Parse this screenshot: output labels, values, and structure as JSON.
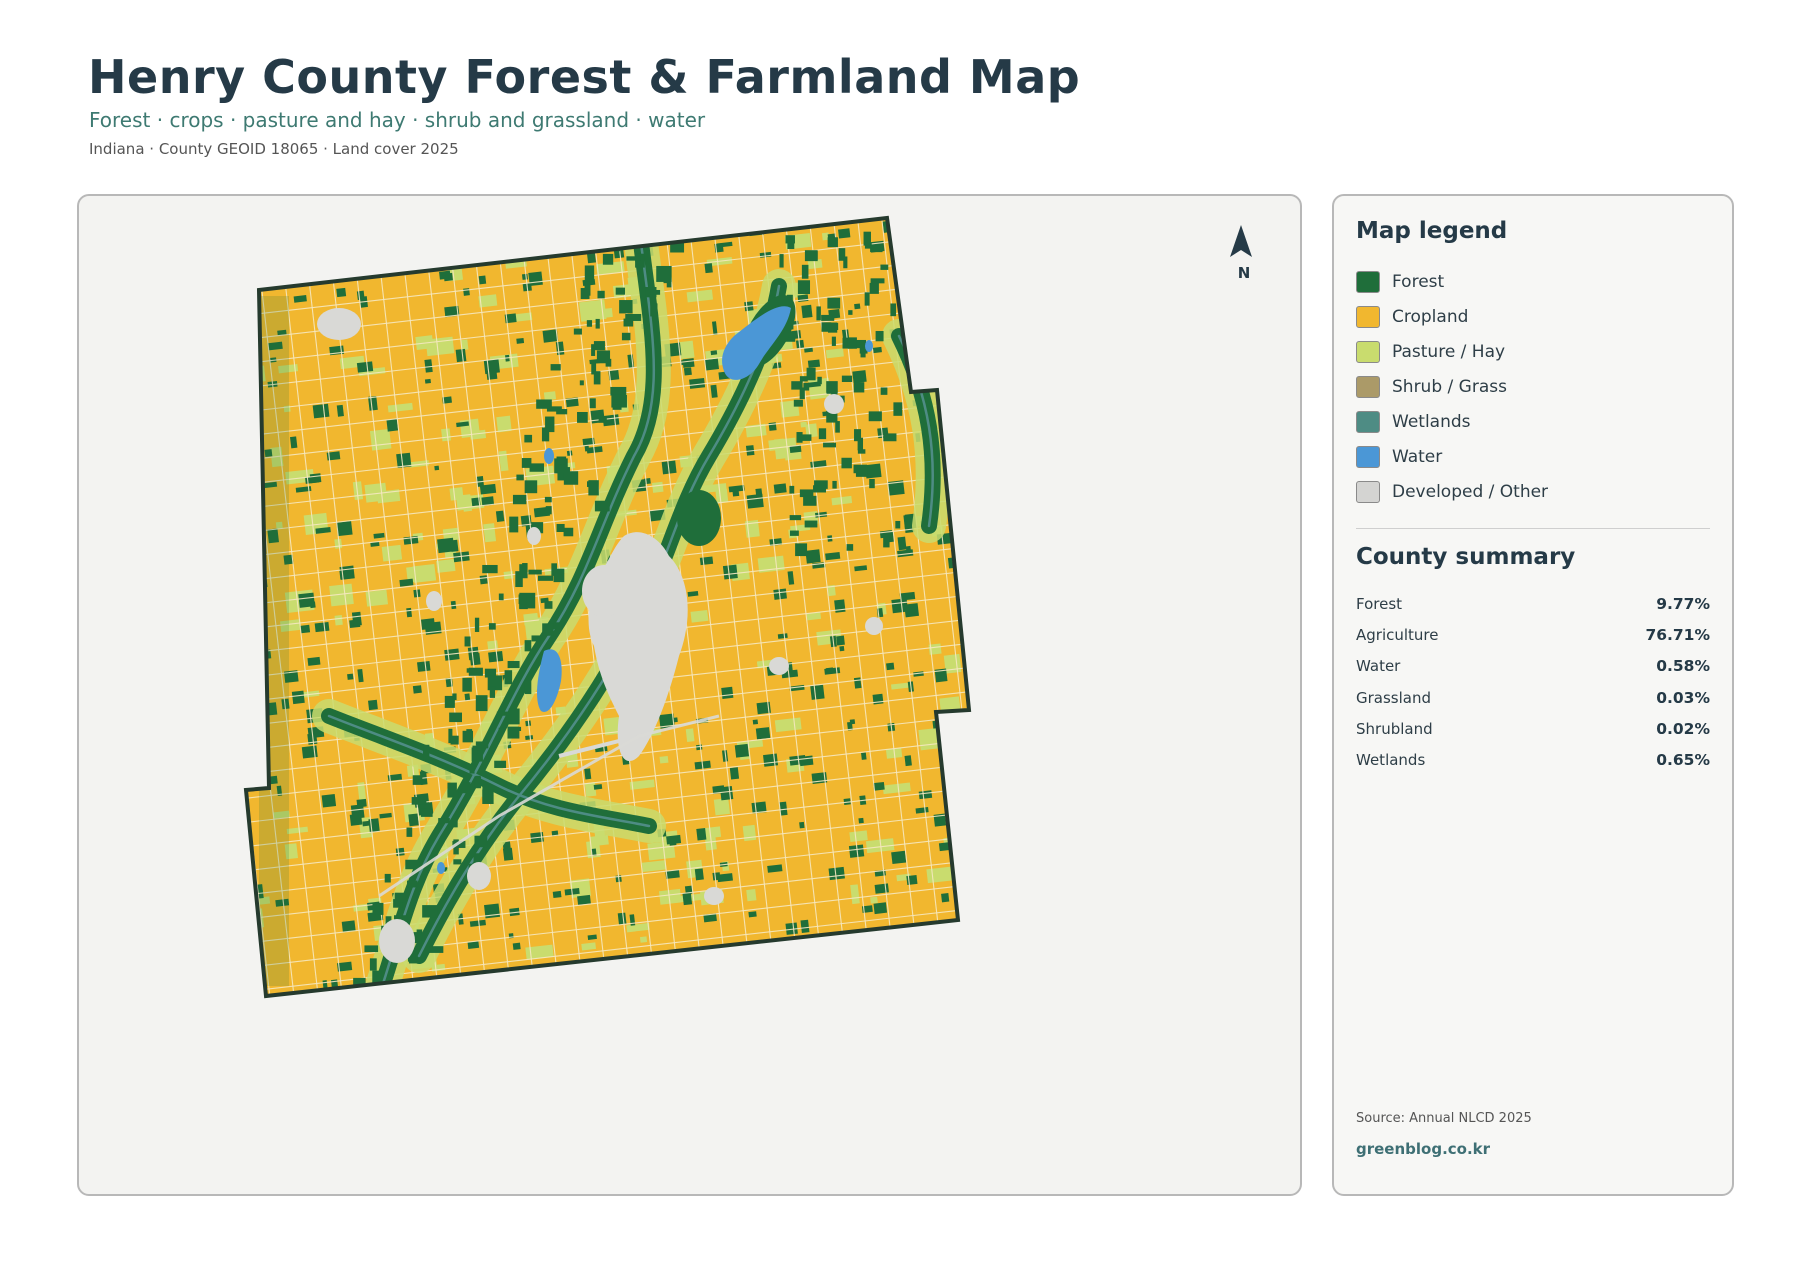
{
  "header": {
    "title": "Henry County Forest & Farmland Map",
    "subtitle": "Forest · crops · pasture and hay · shrub and grassland · water",
    "meta": "Indiana · County GEOID 18065 · Land cover 2025"
  },
  "map": {
    "north_label": "N",
    "colors": {
      "forest": "#1f6e3a",
      "cropland": "#f1b72f",
      "pasture": "#c9dc6e",
      "shrub": "#ab9a68",
      "wetlands": "#4e8c84",
      "water": "#4b97d6",
      "developed": "#d9d9d6",
      "outline": "#253a2e",
      "panel": "#f3f3f1"
    },
    "icons": {
      "north": "north-arrow-icon"
    }
  },
  "legend": {
    "title": "Map legend",
    "items": [
      {
        "label": "Forest",
        "color": "#1f6e3a"
      },
      {
        "label": "Cropland",
        "color": "#f1b72f"
      },
      {
        "label": "Pasture / Hay",
        "color": "#c9dc6e"
      },
      {
        "label": "Shrub / Grass",
        "color": "#ab9a68"
      },
      {
        "label": "Wetlands",
        "color": "#4e8c84"
      },
      {
        "label": "Water",
        "color": "#4b97d6"
      },
      {
        "label": "Developed / Other",
        "color": "#d4d4d2"
      }
    ]
  },
  "summary": {
    "title": "County summary",
    "rows": [
      {
        "name": "Forest",
        "value": "9.77%"
      },
      {
        "name": "Agriculture",
        "value": "76.71%"
      },
      {
        "name": "Water",
        "value": "0.58%"
      },
      {
        "name": "Grassland",
        "value": "0.03%"
      },
      {
        "name": "Shrubland",
        "value": "0.02%"
      },
      {
        "name": "Wetlands",
        "value": "0.65%"
      }
    ]
  },
  "footer": {
    "source": "Source: Annual NLCD 2025",
    "brand": "greenblog.co.kr"
  }
}
